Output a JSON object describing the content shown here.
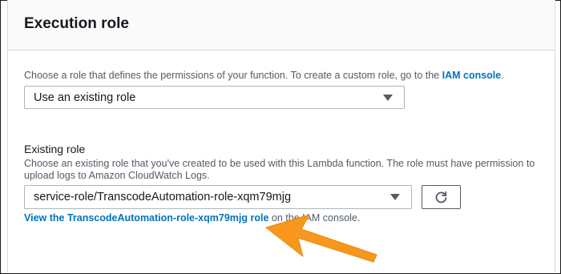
{
  "panel": {
    "title": "Execution role"
  },
  "role_choice": {
    "description_prefix": "Choose a role that defines the permissions of your function. To create a custom role, go to the",
    "iam_console_link": "IAM console",
    "description_suffix": ".",
    "selected_value": "Use an existing role"
  },
  "existing_role": {
    "label": "Existing role",
    "description": "Choose an existing role that you've created to be used with this Lambda function. The role must have permission to upload logs to Amazon CloudWatch Logs.",
    "selected_value": "service-role/TranscodeAutomation-role-xqm79mjg",
    "view_link": "View the TranscodeAutomation-role-xqm79mjg role",
    "view_suffix": "on the IAM console."
  },
  "icons": {
    "refresh": "refresh-icon",
    "caret": "chevron-down-icon",
    "annotation": "orange-arrow"
  },
  "colors": {
    "link": "#0073bb",
    "annotation_arrow": "#f7981d"
  }
}
